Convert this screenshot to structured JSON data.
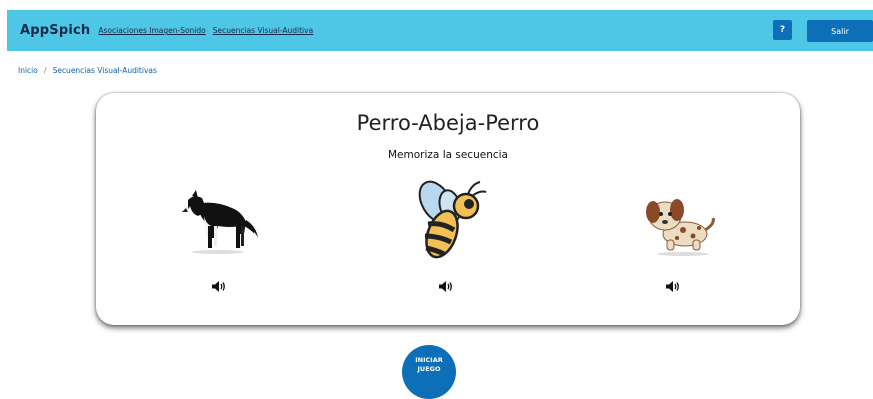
{
  "navbar": {
    "brand": "AppSpich",
    "links": [
      "Asociaciones Imagen-Sonido",
      "Secuencias Visual-Auditiva"
    ],
    "help_label": "?",
    "logout_label": "Salir",
    "color": "#4ec6e6"
  },
  "breadcrumb": {
    "items": [
      "Inicio",
      "Secuencias Visual-Auditivas"
    ],
    "separator": "/"
  },
  "card": {
    "title": "Perro-Abeja-Perro",
    "subtitle": "Memoriza la secuencia",
    "items": [
      {
        "icon": "dog-border-collie-image",
        "sound_icon": "speaker-icon"
      },
      {
        "icon": "bee-image",
        "sound_icon": "speaker-icon"
      },
      {
        "icon": "spotted-puppy-image",
        "sound_icon": "speaker-icon"
      }
    ]
  },
  "start_button": {
    "line1": "INICIAR",
    "line2": "JUEGO",
    "color": "#0d6fb8"
  }
}
